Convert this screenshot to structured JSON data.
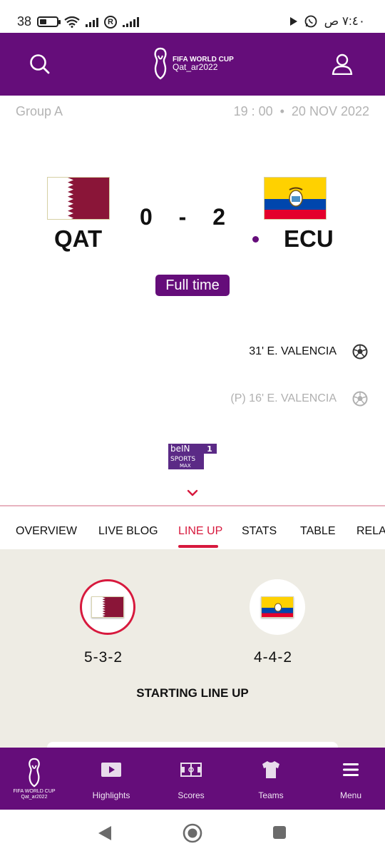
{
  "status_bar": {
    "left_text": "38",
    "battery_level": 0.4,
    "sim_badge": "R",
    "right_text": "٧:٤٠ ص"
  },
  "header": {
    "logo_line1": "FIFA WORLD CUP",
    "logo_line2": "Qat_ar2022",
    "search_icon": "search-icon",
    "profile_icon": "user-icon"
  },
  "match": {
    "group": "Group A",
    "time": "19 : 00",
    "separator": "•",
    "date": "20 NOV 2022",
    "home": {
      "code": "QAT"
    },
    "away": {
      "code": "ECU"
    },
    "home_score": "0",
    "score_separator": "-",
    "away_score": "2",
    "status": "Full time",
    "goals": [
      {
        "text": "31' E. VALENCIA",
        "dimmed": false
      },
      {
        "text": "(P) 16' E. VALENCIA",
        "dimmed": true
      }
    ],
    "broadcaster": {
      "line1": "beIN",
      "line2": "SPORTS",
      "line3": "MAX",
      "channel": "1"
    }
  },
  "tabs": [
    {
      "label": "OVERVIEW",
      "active": false
    },
    {
      "label": "LIVE BLOG",
      "active": false
    },
    {
      "label": "LINE UP",
      "active": true
    },
    {
      "label": "STATS",
      "active": false
    },
    {
      "label": "TABLE",
      "active": false
    },
    {
      "label": "RELATED",
      "active": false
    }
  ],
  "lineup": {
    "home_formation": "5-3-2",
    "away_formation": "4-4-2",
    "title": "STARTING LINE UP"
  },
  "bottom_nav": {
    "logo_line1": "FIFA WORLD CUP",
    "logo_line2": "Qat_ar2022",
    "items": [
      {
        "label": "Highlights",
        "icon": "play-icon"
      },
      {
        "label": "Scores",
        "icon": "pitch-icon"
      },
      {
        "label": "Teams",
        "icon": "shirt-icon"
      },
      {
        "label": "Menu",
        "icon": "menu-icon"
      }
    ]
  },
  "colors": {
    "brand_purple": "#650d7a",
    "accent_red": "#d7193d",
    "lineup_bg": "#eeece4",
    "qatar_maroon": "#8a1538"
  }
}
